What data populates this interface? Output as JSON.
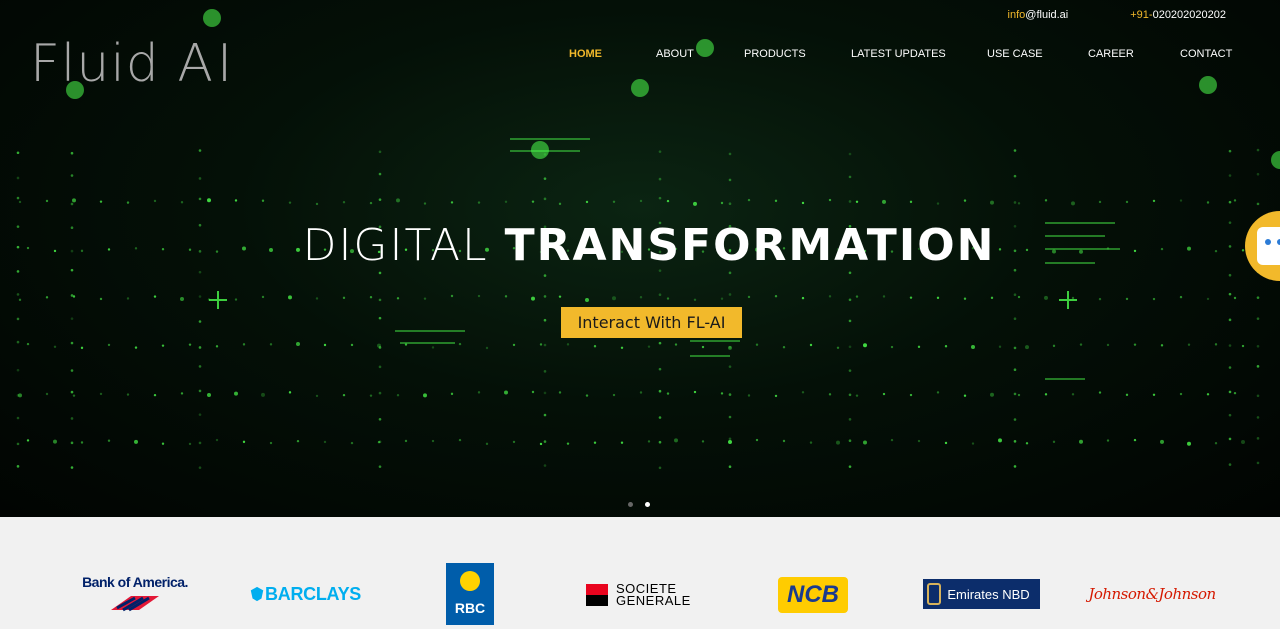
{
  "header": {
    "logo_text_main": "Fluid",
    "logo_text_ai": "AI",
    "email": {
      "prefix": "info",
      "rest": "@fluid.ai"
    },
    "phone": {
      "prefix": "+91-",
      "number": "020202020202"
    }
  },
  "nav": {
    "items": [
      {
        "label": "HOME",
        "active": true
      },
      {
        "label": "ABOUT",
        "active": false
      },
      {
        "label": "PRODUCTS",
        "active": false
      },
      {
        "label": "LATEST UPDATES",
        "active": false
      },
      {
        "label": "USE CASE",
        "active": false
      },
      {
        "label": "CAREER",
        "active": false
      },
      {
        "label": "CONTACT",
        "active": false
      }
    ]
  },
  "hero": {
    "headline_light": "DIGITAL",
    "headline_bold": "TRANSFORMATION",
    "cta_label": "Interact With FL-AI",
    "slide_count": 2,
    "active_slide": 2
  },
  "chat_widget": {
    "icon": "chatbot-icon"
  },
  "clients": [
    {
      "name": "Bank of America",
      "text": "Bank of America."
    },
    {
      "name": "Barclays",
      "text": "BARCLAYS"
    },
    {
      "name": "RBC",
      "text": "RBC"
    },
    {
      "name": "Societe Generale",
      "line1": "SOCIETE",
      "line2": "GENERALE"
    },
    {
      "name": "NCB",
      "text": "NCB"
    },
    {
      "name": "Emirates NBD",
      "text": "Emirates NBD"
    },
    {
      "name": "Johnson & Johnson",
      "text": "Johnson&Johnson"
    }
  ],
  "colors": {
    "accent": "#f2b92b",
    "hero_bg": "#041007",
    "matrix_green": "#4cff4c",
    "logos_bg": "#f1f1f1"
  }
}
